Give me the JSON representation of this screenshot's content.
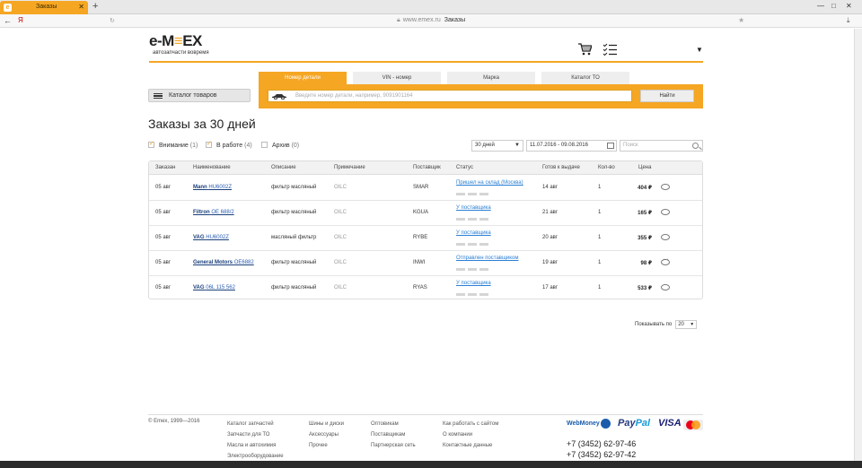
{
  "browser": {
    "tab_title": "Заказы",
    "tab_favicon": "e",
    "tab_close": "✕",
    "new_tab": "+",
    "yandex": "Я",
    "url": "www.emex.ru",
    "page_title": "Заказы",
    "win_min": "—",
    "win_max": "□",
    "win_close": "✕"
  },
  "header": {
    "logo_left": "e",
    "logo_mid": "-M",
    "logo_bars": "≡",
    "logo_right": "EX",
    "tagline": "автозапчасти вовремя"
  },
  "search": {
    "catalog_label": "Каталог товаров",
    "tabs": [
      {
        "label": "Номер детали",
        "active": true
      },
      {
        "label": "VIN - номер",
        "active": false
      },
      {
        "label": "Марка",
        "active": false
      },
      {
        "label": "Каталог ТО",
        "active": false
      }
    ],
    "placeholder": "Введите номер детали, например, 9091901164",
    "button": "Найти"
  },
  "page": {
    "title": "Заказы за 30 дней",
    "filters": [
      {
        "label": "Внимание",
        "count": "(1)",
        "checked": true
      },
      {
        "label": "В работе",
        "count": "(4)",
        "checked": true
      },
      {
        "label": "Архив",
        "count": "(0)",
        "checked": false
      }
    ],
    "period": "30 дней",
    "date_range": "11.07.2016 - 09.08.2016",
    "search_placeholder": "Поиск"
  },
  "table": {
    "headers": [
      "Заказан",
      "Наименование",
      "Описание",
      "Примечание",
      "Поставщик",
      "Статус",
      "Готов к выдаче",
      "Кол-во",
      "Цена"
    ],
    "rows": [
      {
        "date": "05 авг",
        "brand": "Mann",
        "article": "HU6002Z",
        "desc": "фильтр масляный",
        "note": "OILC",
        "supplier": "SMAR",
        "status": "Пришел на склад (Москва)",
        "ready": "14 авг",
        "qty": "1",
        "price": "404 ₽",
        "msg": "plain"
      },
      {
        "date": "05 авг",
        "brand": "Filtron",
        "article": "OE 688/2",
        "desc": "фильтр масляный",
        "note": "OILC",
        "supplier": "KGUA",
        "status": "У поставщика",
        "ready": "21 авг",
        "qty": "1",
        "price": "165 ₽",
        "msg": "plain"
      },
      {
        "date": "05 авг",
        "brand": "VAG",
        "article": "HU6002Z",
        "desc": "масляный фильтр",
        "note": "OILC",
        "supplier": "RYBE",
        "status": "У поставщика",
        "ready": "20 авг",
        "qty": "1",
        "price": "355 ₽",
        "msg": "plain"
      },
      {
        "date": "05 авг",
        "brand": "General Motors",
        "article": "OE6882",
        "desc": "фильтр масляный",
        "note": "OILC",
        "supplier": "INWI",
        "status": "Отправлен поставщиком",
        "ready": "19 авг",
        "qty": "1",
        "price": "98 ₽",
        "msg": "dots"
      },
      {
        "date": "05 авг",
        "brand": "VAG",
        "article": "06L 115 562",
        "desc": "фильтр масляный",
        "note": "OILC",
        "supplier": "RYAS",
        "status": "У поставщика",
        "ready": "17 авг",
        "qty": "1",
        "price": "533 ₽",
        "msg": "plain"
      }
    ]
  },
  "pager": {
    "label": "Показывать по",
    "value": "20"
  },
  "footer": {
    "copyright": "© Emex, 1999—2016",
    "col1": [
      "Каталог запчастей",
      "Запчасти для ТО",
      "Масла и автохимия",
      "Электрооборудование"
    ],
    "col2": [
      "Шины и диски",
      "Аксессуары",
      "Прочее"
    ],
    "col3": [
      "Оптовикам",
      "Поставщикам",
      "Партнерская сеть"
    ],
    "col4": [
      "Как работать с сайтом",
      "О компании",
      "Контактные данные"
    ],
    "pay_webmoney": "WebMoney",
    "pay_paypal_1": "Pay",
    "pay_paypal_2": "Pal",
    "pay_visa": "VISA",
    "phones": [
      "+7 (3452) 62-97-46",
      "+7 (3452) 62-97-42"
    ]
  },
  "colors": {
    "accent": "#f5a623",
    "link": "#2a7fd4"
  }
}
